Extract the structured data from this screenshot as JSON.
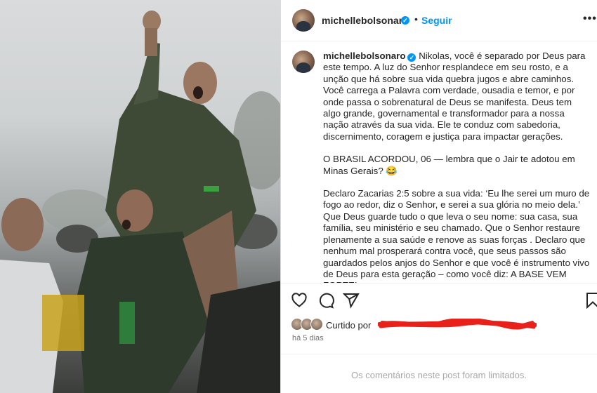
{
  "post": {
    "username": "michellebolsonaro",
    "follow_label": "Seguir",
    "dot": "•",
    "more_label": "•••"
  },
  "caption": {
    "username": "michellebolsonaro",
    "p1": "Nikolas, você é separado por Deus para este tempo. A luz do Senhor resplandece em seu rosto, e a unção que há sobre sua vida quebra jugos e abre caminhos. Você carrega a Palavra com verdade, ousadia e temor, e por onde passa o sobrenatural de Deus se manifesta. Deus tem algo grande, governamental e transformador para a nossa nação através da sua vida. Ele te conduz com sabedoria, discernimento, coragem e justiça para impactar gerações.",
    "p2": "O BRASIL ACORDOU, 06 — lembra que o Jair te adotou em Minas Gerais? 😂",
    "p3": "Declaro Zacarias 2:5 sobre a sua vida: ‘Eu lhe serei um muro de fogo ao redor, diz o Senhor, e serei a sua glória no meio dela.’ Que Deus guarde tudo o que leva o seu nome: sua casa, sua família, seu ministério e seu chamado. Que o Senhor restaure plenamente a sua saúde e renove as suas forças . Declaro que nenhum mal prosperará contra você, que seus passos são guardados pelos anjos do Senhor e que você é instrumento vivo de Deus para esta geração – como você diz: A BASE VEM FORTE!"
  },
  "icons": {
    "like": "heart-icon",
    "comment": "comment-icon",
    "share": "share-icon",
    "save": "bookmark-icon",
    "verified": "verified-badge-icon"
  },
  "likes": {
    "prefix": "Curtido por"
  },
  "time_ago": "há 5 dias",
  "comments_limited": "Os comentários neste post foram limitados.",
  "colors": {
    "accent": "#0095f6",
    "redaction": "#e8211b"
  }
}
